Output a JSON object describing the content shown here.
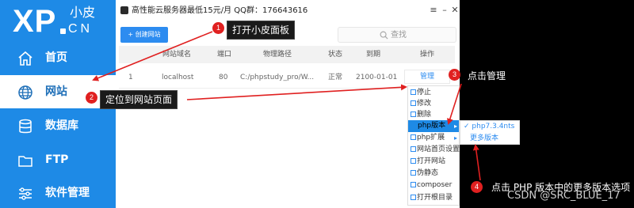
{
  "app": {
    "logo": {
      "main": "XP",
      "top": "小皮",
      "bottom": "CN"
    },
    "title": "高性能云服务器最低15元/月  QQ群：176643616",
    "window_buttons": {
      "menu": "≡",
      "minimize": "–",
      "close": "✕"
    }
  },
  "sidebar": {
    "items": [
      {
        "label": "首页",
        "icon": "home-icon"
      },
      {
        "label": "网站",
        "icon": "globe-icon",
        "active": true
      },
      {
        "label": "数据库",
        "icon": "database-icon"
      },
      {
        "label": "FTP",
        "icon": "folder-icon"
      },
      {
        "label": "软件管理",
        "icon": "sliders-icon"
      }
    ]
  },
  "toolbar": {
    "create_label": "+ 创建网站",
    "search_placeholder": "查找"
  },
  "table": {
    "headers": [
      "网站域名",
      "端口",
      "物理路径",
      "状态",
      "到期",
      "操作"
    ],
    "row": {
      "index": "1",
      "domain": "localhost",
      "port": "80",
      "path": "C:/phpstudy_pro/W...",
      "status": "正常",
      "expiry": "2100-01-01",
      "action": "管理"
    }
  },
  "menu": {
    "items": [
      "停止",
      "修改",
      "删除",
      "php版本",
      "php扩展",
      "网站首页设置",
      "打开网站",
      "伪静态",
      "composer",
      "打开根目录"
    ],
    "highlighted": "php版本",
    "submenu": [
      "php7.3.4nts",
      "更多版本"
    ],
    "submenu_selected": "php7.3.4nts"
  },
  "annotations": {
    "steps": [
      {
        "n": "1",
        "text": "打开小皮面板"
      },
      {
        "n": "2",
        "text": "定位到网站页面"
      },
      {
        "n": "3",
        "text": "点击管理"
      },
      {
        "n": "4",
        "text": "点击 PHP 版本中的更多版本选项"
      }
    ],
    "watermark": "CSDN @SRC_BLUE_17",
    "accent": "#e02020",
    "sidebar_color": "#1e8ae6",
    "primary_color": "#2d8cf0"
  }
}
